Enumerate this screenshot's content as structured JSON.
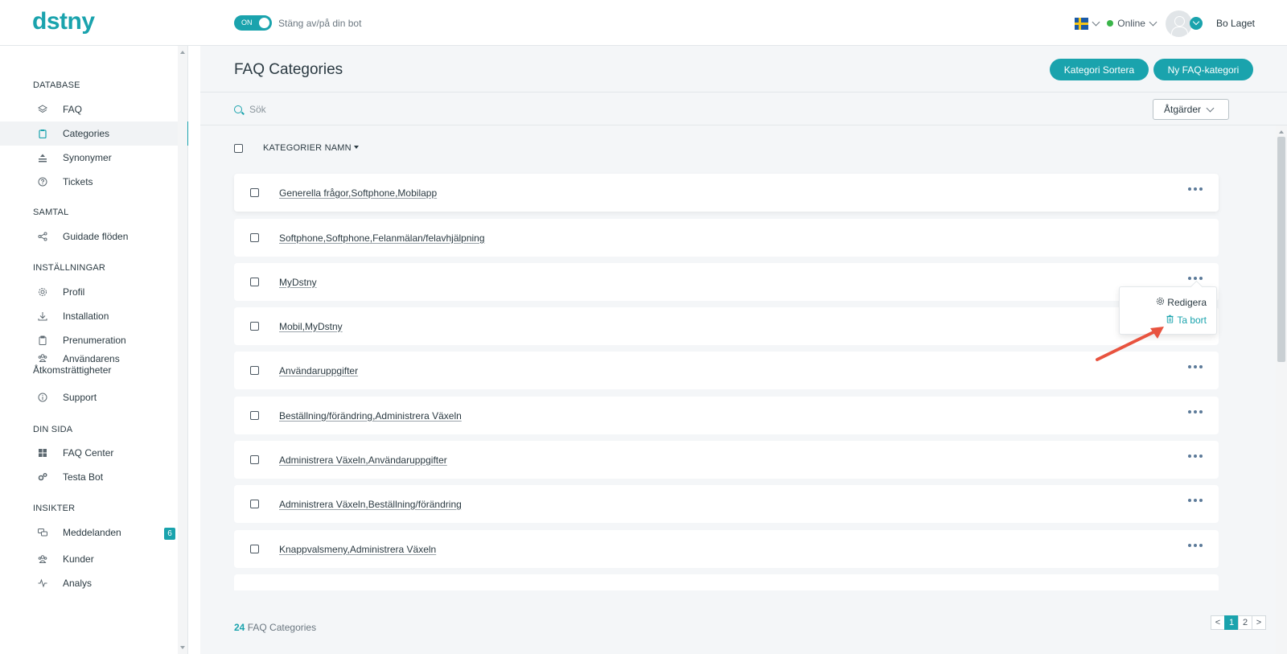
{
  "header": {
    "logo": "dstny",
    "toggle_label": "ON",
    "toggle_text": "Stäng av/på din bot",
    "language_flag": "swedish-flag-icon",
    "status": "Online",
    "username": "Bo Laget",
    "accent_color": "#1aa3ad"
  },
  "sidebar": {
    "sections": [
      {
        "title": "DATABASE",
        "items": [
          {
            "label": "FAQ",
            "icon": "layers-icon"
          },
          {
            "label": "Categories",
            "icon": "clipboard-icon",
            "active": true
          },
          {
            "label": "Synonymer",
            "icon": "stack-icon"
          },
          {
            "label": "Tickets",
            "icon": "help-circle-icon"
          }
        ]
      },
      {
        "title": "SAMTAL",
        "items": [
          {
            "label": "Guidade flöden",
            "icon": "share-icon"
          }
        ]
      },
      {
        "title": "INSTÄLLNINGAR",
        "items": [
          {
            "label": "Profil",
            "icon": "gear-icon"
          },
          {
            "label": "Installation",
            "icon": "download-icon"
          },
          {
            "label": "Prenumeration",
            "icon": "clipboard-icon"
          },
          {
            "label": "Användarens Åtkomsträttigheter",
            "icon": "users-icon"
          },
          {
            "label": "Support",
            "icon": "info-icon"
          }
        ]
      },
      {
        "title": "DIN SIDA",
        "items": [
          {
            "label": "FAQ Center",
            "icon": "grid-icon"
          },
          {
            "label": "Testa Bot",
            "icon": "gears-icon"
          }
        ]
      },
      {
        "title": "INSIKTER",
        "items": [
          {
            "label": "Meddelanden",
            "icon": "chat-icon",
            "badge": "6"
          },
          {
            "label": "Kunder",
            "icon": "users-icon"
          },
          {
            "label": "Analys",
            "icon": "activity-icon"
          }
        ]
      }
    ]
  },
  "main": {
    "title": "FAQ Categories",
    "sort_button": "Kategori Sortera",
    "new_button": "Ny FAQ-kategori",
    "search_placeholder": "Sök",
    "actions_button": "Åtgärder",
    "column_header": "KATEGORIER NAMN",
    "rows": [
      "Generella frågor,Softphone,Mobilapp",
      "Softphone,Softphone,Felanmälan/felavhjälpning",
      "MyDstny",
      "Mobil,MyDstny",
      "Användaruppgifter",
      "Beställning/förändring,Administrera Växeln",
      "Administrera Växeln,Användaruppgifter",
      "Administrera Växeln,Beställning/förändring",
      "Knappvalsmeny,Administrera Växeln"
    ],
    "dropdown": {
      "edit": "Redigera",
      "delete": "Ta bort"
    },
    "footer": {
      "count": "24",
      "count_label": "FAQ Categories",
      "pages": [
        "<",
        "1",
        "2",
        ">"
      ],
      "current_page": "1"
    }
  }
}
